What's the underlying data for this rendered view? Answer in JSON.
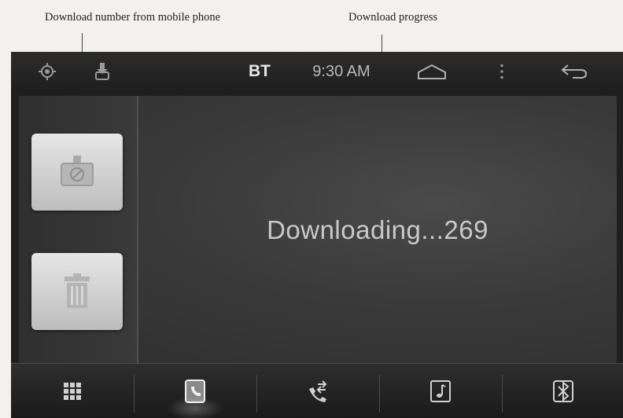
{
  "annotations": {
    "download_number": "Download number from mobile phone",
    "download_progress": "Download progress"
  },
  "statusbar": {
    "bt_label": "BT",
    "time": "9:30 AM",
    "icons": [
      "gps-icon",
      "download-icon",
      "home-icon",
      "menu-icon",
      "back-icon"
    ]
  },
  "sidepanel": {
    "buttons": [
      "download-contacts-icon",
      "trash-icon"
    ]
  },
  "main": {
    "status_text": "Downloading...269"
  },
  "dock": {
    "items": [
      "apps-grid-icon",
      "phonebook-icon",
      "call-log-icon",
      "music-icon",
      "bt-settings-icon"
    ],
    "active_index": 1
  },
  "colors": {
    "screen_bg": "#1f1f1f",
    "button_face": "#d6d6d6",
    "text_light": "#c9c9c9"
  }
}
